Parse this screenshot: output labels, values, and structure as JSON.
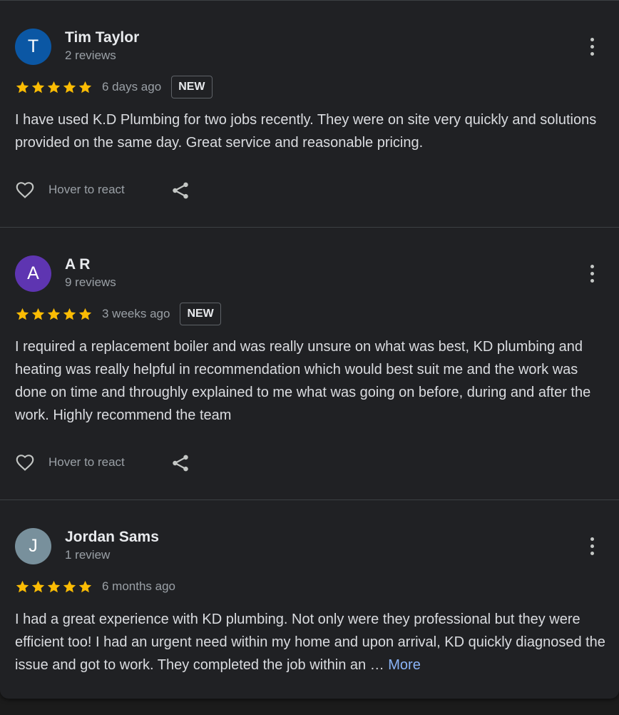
{
  "reviews": [
    {
      "avatar_letter": "T",
      "avatar_color": "#0b57a4",
      "name": "Tim Taylor",
      "review_count": "2 reviews",
      "rating": 5,
      "date": "6 days ago",
      "badge": "NEW",
      "text": "I have used K.D Plumbing for two jobs recently. They were on site very quickly and solutions provided on the same day. Great service and reasonable pricing.",
      "react_label": "Hover to react"
    },
    {
      "avatar_letter": "A",
      "avatar_color": "#5e35b1",
      "name": "A R",
      "review_count": "9 reviews",
      "rating": 5,
      "date": "3 weeks ago",
      "badge": "NEW",
      "text": "I required a replacement boiler and was really unsure on what was best, KD plumbing and heating was really helpful in recommendation which would best suit me and the work was done on time and throughly explained to me what was going on before, during and after the work. Highly recommend the team",
      "react_label": "Hover to react"
    },
    {
      "avatar_letter": "J",
      "avatar_color": "#78909c",
      "name": "Jordan Sams",
      "review_count": "1 review",
      "rating": 5,
      "date": "6 months ago",
      "text": "I had a great experience with KD plumbing. Not only were they professional but they were efficient too! I had an urgent need within my home and upon arrival, KD quickly diagnosed the issue and got to work. They completed the job within an …",
      "more_label": "More"
    }
  ],
  "colors": {
    "star": "#fbbc04",
    "link": "#8ab4f8",
    "background": "#202124"
  },
  "icons": {
    "star": "star-icon",
    "menu": "more-vert-icon",
    "react": "heart-outline-icon",
    "share": "share-icon"
  }
}
